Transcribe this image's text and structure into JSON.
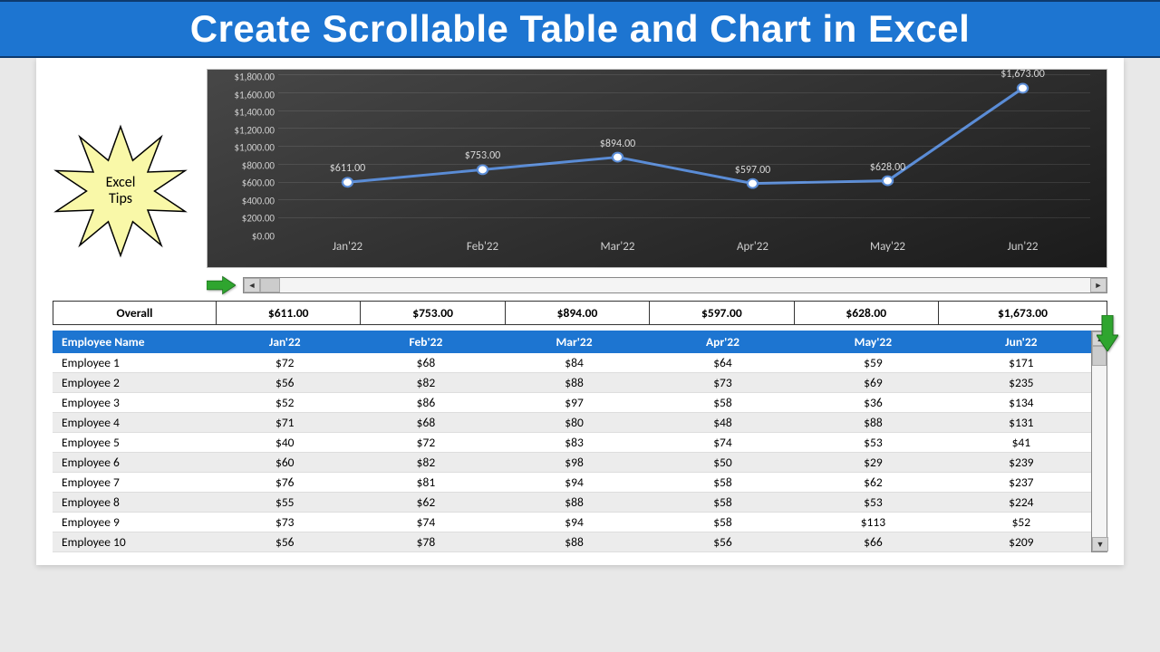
{
  "banner": {
    "title": "Create Scrollable Table and Chart in Excel"
  },
  "tips": {
    "line1": "Excel",
    "line2": "Tips"
  },
  "chart_data": {
    "type": "line",
    "title": "",
    "xlabel": "",
    "ylabel": "",
    "categories": [
      "Jan'22",
      "Feb'22",
      "Mar'22",
      "Apr'22",
      "May'22",
      "Jun'22"
    ],
    "values": [
      611.0,
      753.0,
      894.0,
      597.0,
      628.0,
      1673.0
    ],
    "data_labels": [
      "$611.00",
      "$753.00",
      "$894.00",
      "$597.00",
      "$628.00",
      "$1,673.00"
    ],
    "ylim": [
      0,
      1800
    ],
    "yticks": [
      "$0.00",
      "$200.00",
      "$400.00",
      "$600.00",
      "$800.00",
      "$1,000.00",
      "$1,200.00",
      "$1,400.00",
      "$1,600.00",
      "$1,800.00"
    ]
  },
  "overall": {
    "label": "Overall",
    "values": [
      "$611.00",
      "$753.00",
      "$894.00",
      "$597.00",
      "$628.00",
      "$1,673.00"
    ]
  },
  "table": {
    "columns": [
      "Employee Name",
      "Jan'22",
      "Feb'22",
      "Mar'22",
      "Apr'22",
      "May'22",
      "Jun'22"
    ],
    "rows": [
      [
        "Employee 1",
        "$72",
        "$68",
        "$84",
        "$64",
        "$59",
        "$171"
      ],
      [
        "Employee 2",
        "$56",
        "$82",
        "$88",
        "$73",
        "$69",
        "$235"
      ],
      [
        "Employee 3",
        "$52",
        "$86",
        "$97",
        "$58",
        "$36",
        "$134"
      ],
      [
        "Employee 4",
        "$71",
        "$68",
        "$80",
        "$48",
        "$88",
        "$131"
      ],
      [
        "Employee 5",
        "$40",
        "$72",
        "$83",
        "$74",
        "$53",
        "$41"
      ],
      [
        "Employee 6",
        "$60",
        "$82",
        "$98",
        "$50",
        "$29",
        "$239"
      ],
      [
        "Employee 7",
        "$76",
        "$81",
        "$94",
        "$58",
        "$62",
        "$237"
      ],
      [
        "Employee 8",
        "$55",
        "$62",
        "$88",
        "$58",
        "$53",
        "$224"
      ],
      [
        "Employee 9",
        "$73",
        "$74",
        "$94",
        "$58",
        "$113",
        "$52"
      ],
      [
        "Employee 10",
        "$56",
        "$78",
        "$88",
        "$56",
        "$66",
        "$209"
      ]
    ]
  }
}
